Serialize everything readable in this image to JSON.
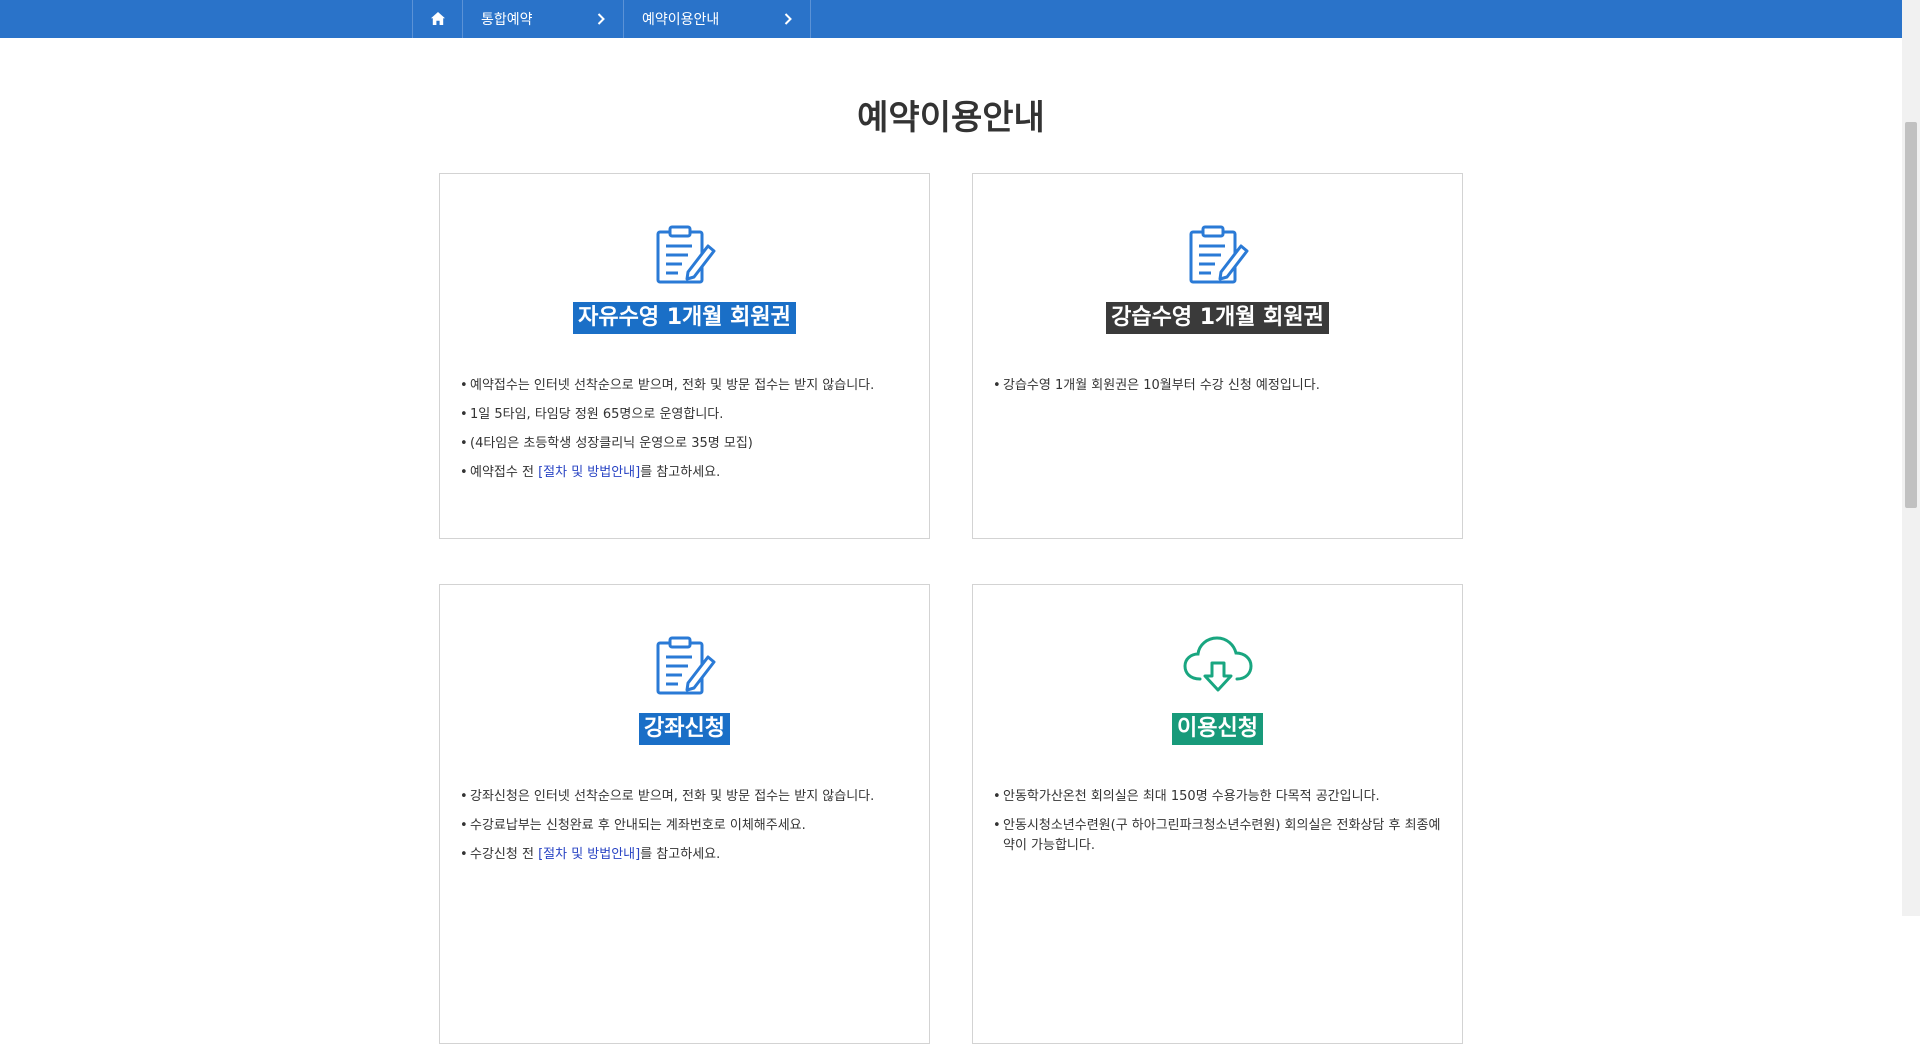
{
  "colors": {
    "header_bar": "#2a73c9",
    "title_blue": "#1a6fc7",
    "title_dark": "#3a3a3a",
    "title_green": "#189a7a",
    "icon_blue": "#2a7ad6",
    "icon_green": "#19a680",
    "link": "#2a45c4"
  },
  "breadcrumb": {
    "home_icon": "home-icon",
    "items": [
      {
        "label": "통합예약"
      },
      {
        "label": "예약이용안내"
      }
    ]
  },
  "page": {
    "title": "예약이용안내"
  },
  "cards": [
    {
      "icon": "clipboard-pencil-icon",
      "title": "자유수영 1개월 회원권",
      "items": [
        {
          "text": "예약접수는 인터넷 선착순으로 받으며, 전화 및 방문 접수는 받지 않습니다."
        },
        {
          "text": "1일 5타임, 타임당 정원 65명으로 운영합니다."
        },
        {
          "text": "(4타임은 초등학생 성장클리닉 운영으로 35명 모집)"
        },
        {
          "prefix": "예약접수 전 ",
          "link": "[절차 및 방법안내]",
          "suffix": "를 참고하세요."
        }
      ]
    },
    {
      "icon": "clipboard-pencil-icon",
      "title": "강습수영 1개월 회원권",
      "items": [
        {
          "text": "강습수영 1개월 회원권은 10월부터 수강 신청 예정입니다."
        }
      ]
    },
    {
      "icon": "clipboard-pencil-icon",
      "title": "강좌신청",
      "items": [
        {
          "text": "강좌신청은 인터넷 선착순으로 받으며, 전화 및 방문 접수는 받지 않습니다."
        },
        {
          "text": "수강료납부는 신청완료 후 안내되는 계좌번호로 이체해주세요."
        },
        {
          "prefix": "수강신청 전 ",
          "link": "[절차 및 방법안내]",
          "suffix": "를 참고하세요."
        }
      ]
    },
    {
      "icon": "cloud-download-icon",
      "title": "이용신청",
      "items": [
        {
          "text": "안동학가산온천 회의실은 최대 150명 수용가능한 다목적 공간입니다."
        },
        {
          "text": "안동시청소년수련원(구 하아그린파크청소년수련원) 회의실은 전화상담 후 최종예약이 가능합니다."
        }
      ]
    }
  ]
}
